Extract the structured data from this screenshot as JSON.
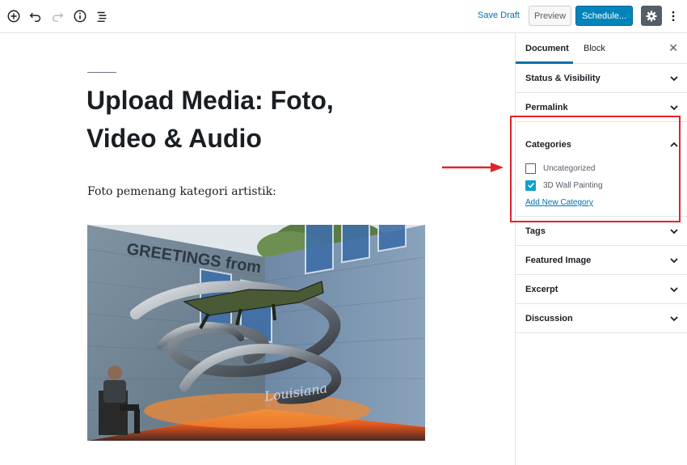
{
  "toolbar": {
    "icons": [
      "add-block-icon",
      "undo-icon",
      "redo-icon",
      "info-icon",
      "outline-icon"
    ],
    "save_draft_label": "Save Draft",
    "preview_label": "Preview",
    "schedule_label": "Schedule...",
    "settings_icon": "gear-icon",
    "more_icon": "more-vertical-icon"
  },
  "editor": {
    "title": "Upload Media: Foto, Video & Audio",
    "paragraph": "Foto pemenang kategori artistik:",
    "image": {
      "wall_lettering": "GREETINGS from",
      "sub_lettering": "Louisiana"
    }
  },
  "sidebar": {
    "tabs": [
      {
        "label": "Document",
        "active": true
      },
      {
        "label": "Block",
        "active": false
      }
    ],
    "close_label": "✕",
    "panels": {
      "status_visibility": "Status & Visibility",
      "permalink": "Permalink",
      "categories": {
        "label": "Categories",
        "items": [
          {
            "label": "Uncategorized",
            "checked": false
          },
          {
            "label": "3D Wall Painting",
            "checked": true
          }
        ],
        "add_new_label": "Add New Category"
      },
      "tags": "Tags",
      "featured_image": "Featured Image",
      "excerpt": "Excerpt",
      "discussion": "Discussion"
    }
  },
  "colors": {
    "accent": "#0085ba",
    "link": "#0073aa",
    "checkbox": "#11a0d2",
    "annotation": "#e2232c"
  }
}
